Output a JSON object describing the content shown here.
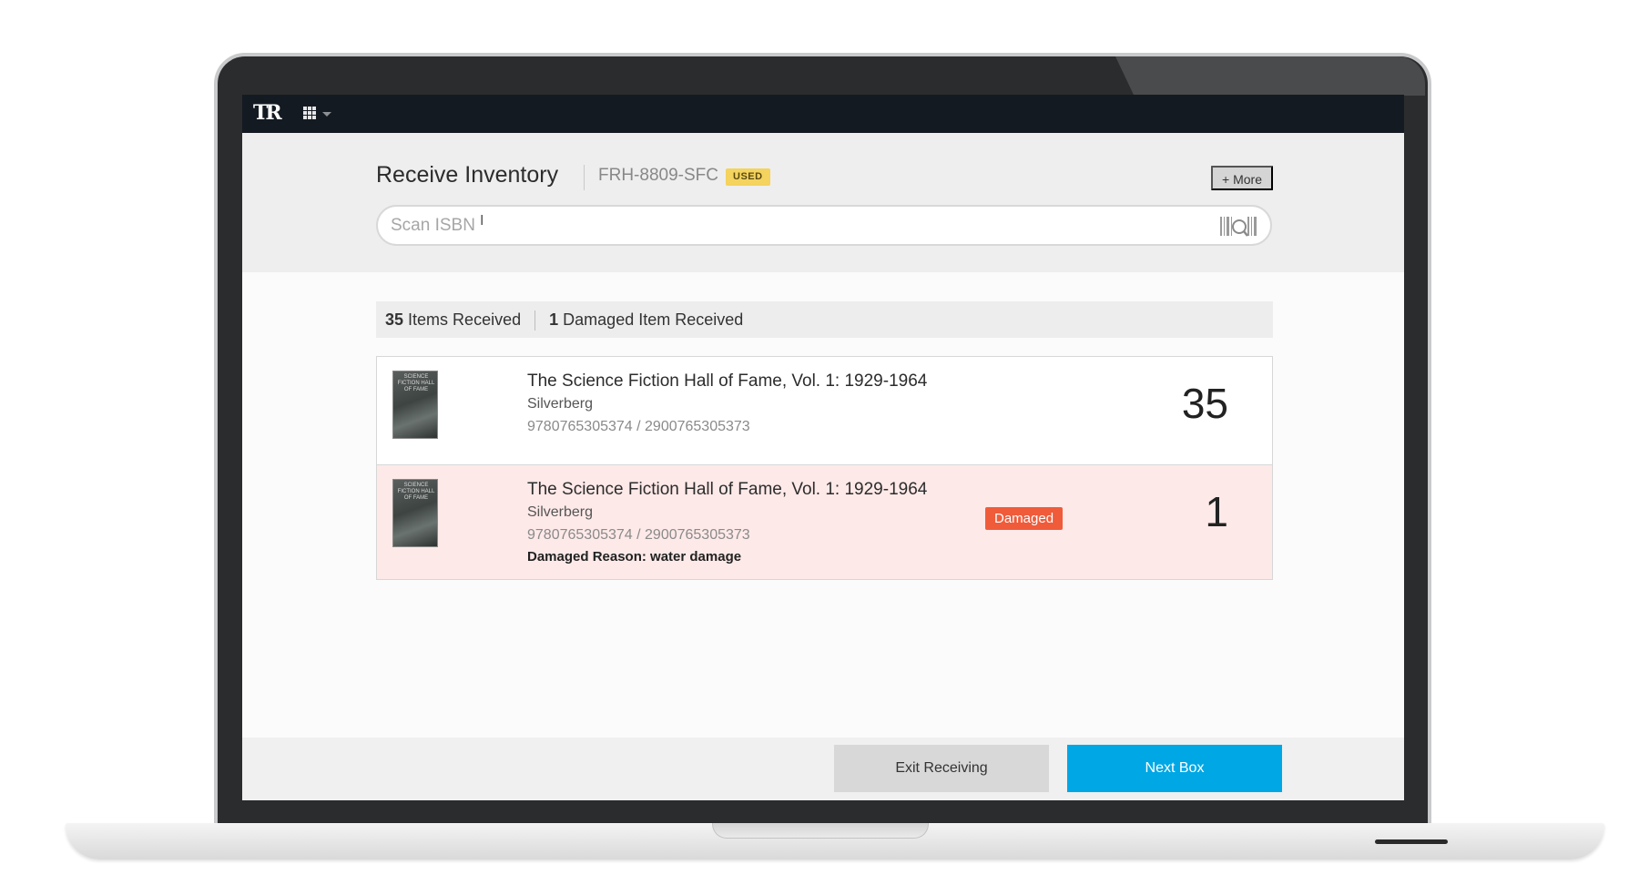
{
  "app": {
    "logo_text": "TR",
    "apps_menu_icon": "grid-icon"
  },
  "header": {
    "title": "Receive Inventory",
    "sku": "FRH-8809-SFC",
    "condition_badge": "USED",
    "more_label": "+ More",
    "search": {
      "placeholder": "Scan ISBN",
      "icon": "barcode-scan-icon"
    }
  },
  "summary": {
    "received_count": "35",
    "received_label": "Items Received",
    "damaged_count": "1",
    "damaged_label": "Damaged Item Received"
  },
  "items": [
    {
      "title": "The Science Fiction Hall of Fame, Vol. 1: 1929-1964",
      "author": "Silverberg",
      "isbn": "9780765305374 / 2900765305373",
      "quantity": "35",
      "cover_text": "SCIENCE FICTION HALL OF FAME",
      "damaged": false
    },
    {
      "title": "The Science Fiction Hall of Fame, Vol. 1: 1929-1964",
      "author": "Silverberg",
      "isbn": "9780765305374 / 2900765305373",
      "reason": "Damaged Reason: water damage",
      "badge": "Damaged",
      "quantity": "1",
      "cover_text": "SCIENCE FICTION HALL OF FAME",
      "damaged": true
    }
  ],
  "footer": {
    "exit_label": "Exit Receiving",
    "next_label": "Next Box"
  },
  "colors": {
    "topbar": "#141a22",
    "accent": "#00a7e5",
    "damaged_badge": "#f05b3a",
    "used_badge": "#f4d35e",
    "damaged_row": "#fde9e8"
  }
}
